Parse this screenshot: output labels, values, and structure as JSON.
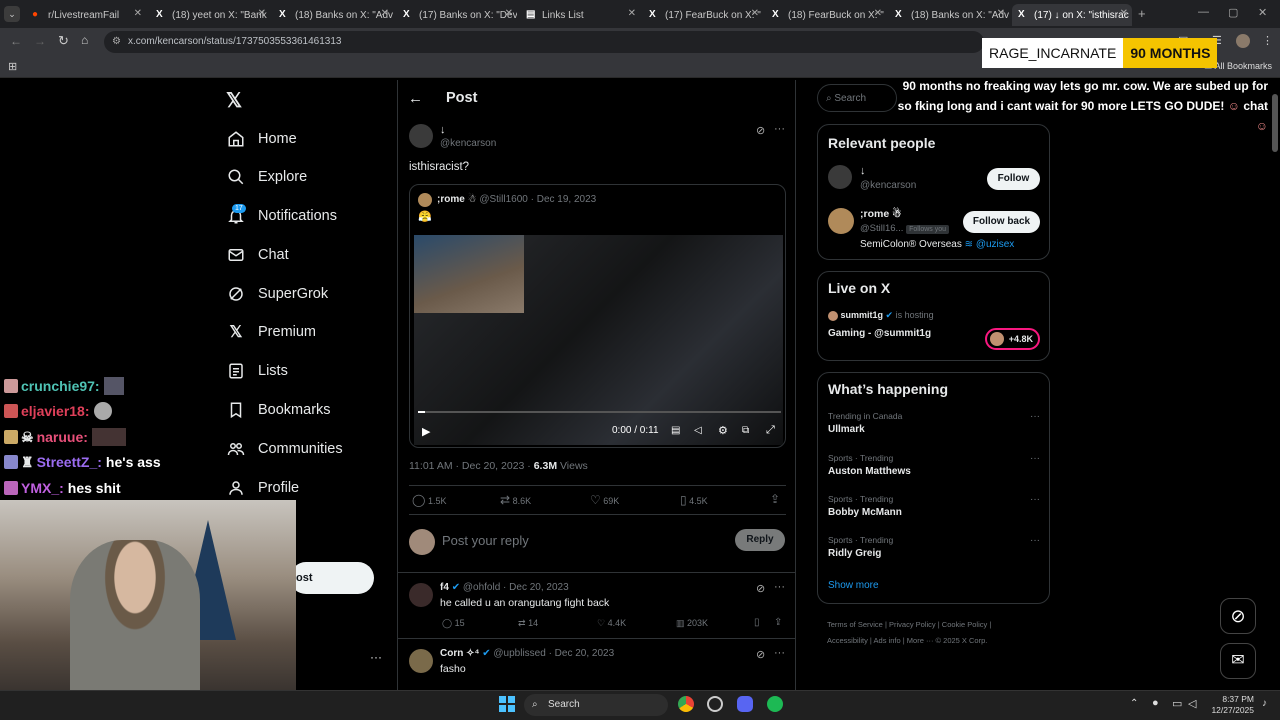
{
  "browser": {
    "tabs": [
      {
        "label": "r/LivestreamFail",
        "icon": "reddit-icon"
      },
      {
        "label": "(18) yeet on X: \"Bank",
        "icon": "x-logo-icon"
      },
      {
        "label": "(18) Banks on X: \"Adv",
        "icon": "x-logo-icon"
      },
      {
        "label": "(17) Banks on X: \"Dev",
        "icon": "x-logo-icon"
      },
      {
        "label": "Links List",
        "icon": "doc-icon"
      },
      {
        "label": "(17) FearBuck on X: \"",
        "icon": "x-logo-icon"
      },
      {
        "label": "(18) FearBuck on X: \"",
        "icon": "x-logo-icon"
      },
      {
        "label": "(18) Banks on X: \"Adv",
        "icon": "x-logo-icon"
      },
      {
        "label": "(17) ↓ on X: \"isthisrac",
        "icon": "x-logo-icon"
      }
    ],
    "url": "x.com/kencarson/status/1737503553361461313",
    "bookmarks_label": "All Bookmarks"
  },
  "overlay": {
    "sub_name": "RAGE_INCARNATE",
    "sub_months": "90 MONTHS",
    "sub_message": "90 months no freaking way lets go mr. cow. We are subed up for so fking long and i cant wait for 90 more LETS GO DUDE!",
    "sub_message_tail": "chat",
    "chat": [
      {
        "user": "crunchie97:",
        "msg": "",
        "color": "#4fc3b4"
      },
      {
        "user": "eljavier18:",
        "msg": "",
        "color": "#e0405a"
      },
      {
        "user": "naruue:",
        "msg": "",
        "color": "#e8507a"
      },
      {
        "user": "StreettZ_:",
        "msg": "he's ass",
        "color": "#9b6cf0"
      },
      {
        "user": "YMX_:",
        "msg": "hes shit",
        "color": "#c060e0"
      }
    ]
  },
  "nav": {
    "items": [
      {
        "label": "Home",
        "icon": "home-icon"
      },
      {
        "label": "Explore",
        "icon": "search-icon"
      },
      {
        "label": "Notifications",
        "icon": "bell-icon"
      },
      {
        "label": "Chat",
        "icon": "mail-icon"
      },
      {
        "label": "SuperGrok",
        "icon": "grok-icon"
      },
      {
        "label": "Premium",
        "icon": "x-logo-icon"
      },
      {
        "label": "Lists",
        "icon": "list-icon"
      },
      {
        "label": "Bookmarks",
        "icon": "bookmark-icon"
      },
      {
        "label": "Communities",
        "icon": "people-icon"
      },
      {
        "label": "Profile",
        "icon": "person-icon"
      }
    ],
    "notif_count": "17",
    "post_button": "ost"
  },
  "post": {
    "header": "Post",
    "author_name": "↓",
    "author_handle": "@kencarson",
    "text": "isthisracist?",
    "quote": {
      "name": ";rome",
      "handle": "@Still1600",
      "date": "· Dec 19, 2023",
      "emoji": "😤"
    },
    "video_time": "0:00 / 0:11",
    "meta_time": "11:01 AM · Dec 20, 2023 ·",
    "views_count": "6.3M",
    "views_label": "Views",
    "stats": {
      "replies": "1.5K",
      "reposts": "8.6K",
      "likes": "69K",
      "bookmarks": "4.5K"
    },
    "reply_placeholder": "Post your reply",
    "reply_button": "Reply"
  },
  "replies": [
    {
      "name": "f4",
      "handle": "@ohfold",
      "date": "· Dec 20, 2023",
      "text": "he called u an orangutang fight back",
      "replies": "15",
      "reposts": "14",
      "likes": "4.4K",
      "views": "203K"
    },
    {
      "name": "Corn ✧⁴",
      "handle": "@upblissed",
      "date": "· Dec 20, 2023",
      "text": "fasho"
    }
  ],
  "right": {
    "search_placeholder": "Search",
    "relevant_title": "Relevant people",
    "people": [
      {
        "name": "↓",
        "handle": "@kencarson",
        "button": "Follow"
      },
      {
        "name": ";rome",
        "handle": "@Still16...",
        "follows_you": "Follows you",
        "button": "Follow back",
        "bio": "SemiColon® Overseas",
        "bio_link": "@uzisex"
      }
    ],
    "live_title": "Live on X",
    "live_host": "summit1g",
    "live_hosting": "is hosting",
    "live_space": "Gaming - @summit1g",
    "live_count": "+4.8K",
    "happening_title": "What’s happening",
    "trends": [
      {
        "context": "Trending in Canada",
        "topic": "Ullmark"
      },
      {
        "context": "Sports · Trending",
        "topic": "Auston Matthews"
      },
      {
        "context": "Sports · Trending",
        "topic": "Bobby McMann"
      },
      {
        "context": "Sports · Trending",
        "topic": "Ridly Greig"
      }
    ],
    "show_more": "Show more",
    "footer": [
      "Terms of Service",
      "Privacy Policy",
      "Cookie Policy",
      "Accessibility",
      "Ads info",
      "More ···",
      "© 2025 X Corp."
    ]
  },
  "taskbar": {
    "search": "Search",
    "time": "8:37 PM",
    "date": "12/27/2025"
  }
}
